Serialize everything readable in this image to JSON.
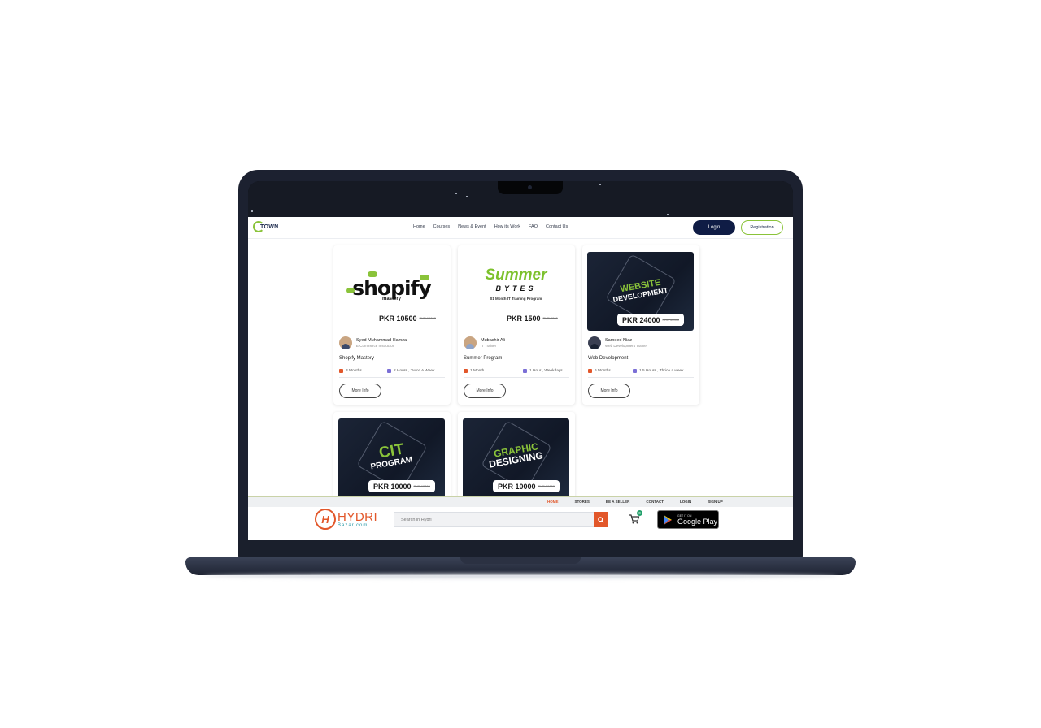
{
  "nav": {
    "logo_text": "TOWN",
    "links": [
      "Home",
      "Courses",
      "News & Event",
      "How its Work",
      "FAQ",
      "Contact Us"
    ],
    "login_label": "Login",
    "registration_label": "Registration"
  },
  "courses": [
    {
      "banner_title": "shopify",
      "banner_subtitle": "mastery",
      "price": "PKR 10500",
      "old_price": "PKR 15000",
      "instructor": "Syed Muhammad Hamza",
      "role": "E Commerce Instructor",
      "name": "Shopify Mastery",
      "duration": "3 Months",
      "schedule": "2 Hours , Twice A Week",
      "button": "More Info"
    },
    {
      "banner_title": "Summer",
      "banner_subtitle": "BYTES",
      "banner_caption": "01 Month IT Training Program",
      "price": "PKR 1500",
      "old_price": "PKR 3000",
      "instructor": "Mubashir Ali",
      "role": "IT Trainer",
      "name": "Summer Program",
      "duration": "1 Month",
      "schedule": "1 Hour , Weekdays",
      "button": "More Info"
    },
    {
      "banner_title": "WEBSITE",
      "banner_subtitle": "DEVELOPMENT",
      "price": "PKR 24000",
      "old_price": "PKR 30000",
      "instructor": "Sameed Niaz",
      "role": "Web Development Trainer",
      "name": "Web Development",
      "duration": "6 Months",
      "schedule": "1.5 Hours , Thrice a week",
      "button": "More Info"
    },
    {
      "banner_title": "CIT",
      "banner_subtitle": "PROGRAM",
      "price": "PKR 10000",
      "old_price": "PKR 15000"
    },
    {
      "banner_title": "GRAPHIC",
      "banner_subtitle": "DESIGNING",
      "price": "PKR 10000",
      "old_price": "PKR 20000"
    }
  ],
  "hydri": {
    "links": [
      "HOME",
      "STORES",
      "BE A SELLER",
      "CONTACT",
      "LOGIN",
      "SIGN UP"
    ],
    "logo_letter": "H",
    "logo_title": "HYDRI",
    "logo_sub": "Bazar.com",
    "search_placeholder": "Search in Hydri",
    "cart_count": "0",
    "gplay_small": "GET IT ON",
    "gplay_big": "Google Play"
  },
  "colors": {
    "accent_green": "#8ac33a",
    "navy": "#0f1c45",
    "hydri_orange": "#e2572a"
  }
}
